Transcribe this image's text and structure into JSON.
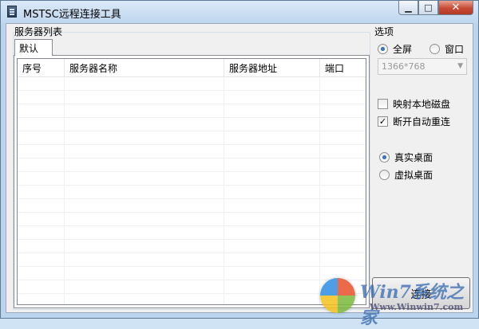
{
  "window": {
    "title": "MSTSC远程连接工具",
    "minimize_label": "▭",
    "maximize_label": "□",
    "close_label": "✕"
  },
  "server_list": {
    "group_label": "服务器列表",
    "tab_label": "默认",
    "columns": [
      "序号",
      "服务器名称",
      "服务器地址",
      "端口"
    ],
    "rows": []
  },
  "options": {
    "group_label": "选项",
    "screen_mode": {
      "fullscreen_label": "全屏",
      "window_label": "窗口",
      "selected": "fullscreen"
    },
    "resolution": {
      "value": "1366*768",
      "enabled": false
    },
    "map_local_disk": {
      "label": "映射本地磁盘",
      "checked": false
    },
    "auto_reconnect": {
      "label": "断开自动重连",
      "checked": true
    },
    "desktop_mode": {
      "real_label": "真实桌面",
      "virtual_label": "虚拟桌面",
      "selected": "real"
    },
    "connect_button_label": "连接"
  },
  "watermark": {
    "brand": "Win7系统之家",
    "url": "Www.Winwin7.com"
  }
}
